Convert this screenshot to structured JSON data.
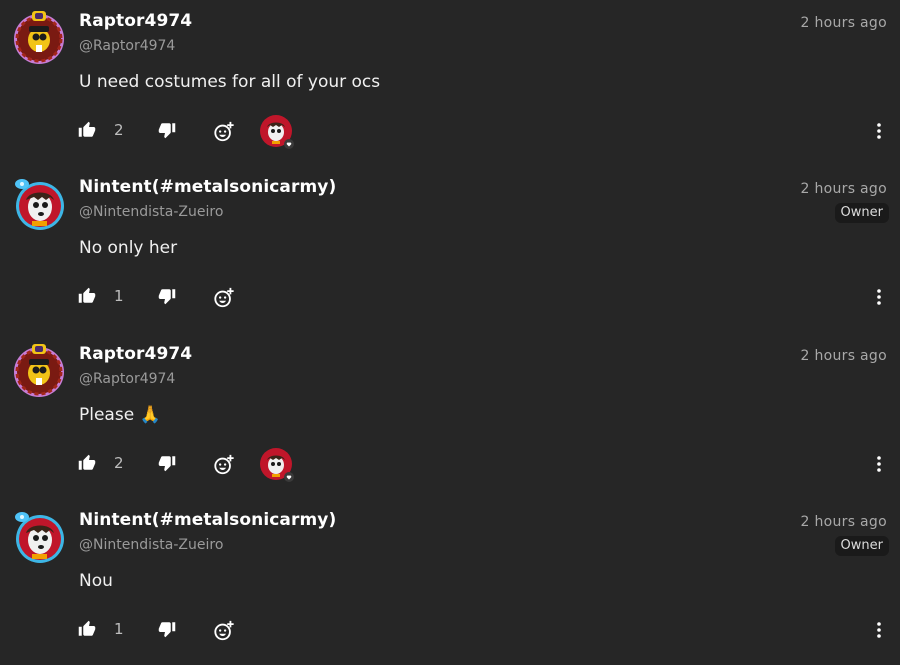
{
  "comments": [
    {
      "username": "Raptor4974",
      "handle": "@Raptor4974",
      "time": "2 hours ago",
      "text": "U need costumes for all of your ocs",
      "likes": "2",
      "is_owner": false,
      "has_reaction_avatar": true
    },
    {
      "username": "Nintent(#metalsonicarmy)",
      "handle": "@Nintendista-Zueiro",
      "time": "2 hours ago",
      "owner_label": "Owner",
      "text": "No only her",
      "likes": "1",
      "is_owner": true,
      "has_reaction_avatar": false
    },
    {
      "username": "Raptor4974",
      "handle": "@Raptor4974",
      "time": "2 hours ago",
      "text": "Please 🙏",
      "likes": "2",
      "is_owner": false,
      "has_reaction_avatar": true
    },
    {
      "username": "Nintent(#metalsonicarmy)",
      "handle": "@Nintendista-Zueiro",
      "time": "2 hours ago",
      "owner_label": "Owner",
      "text": "Nou",
      "likes": "1",
      "is_owner": true,
      "has_reaction_avatar": false
    }
  ],
  "icons": {
    "like": "thumbs-up-icon",
    "dislike": "thumbs-down-icon",
    "react": "add-reaction-icon",
    "more": "more-vertical-icon"
  },
  "colors": {
    "background": "#262626",
    "raptor_avatar_ring": "#c77dd6",
    "nintent_avatar_ring": "#3db6e6",
    "reaction_avatar_bg": "#c0162a"
  }
}
